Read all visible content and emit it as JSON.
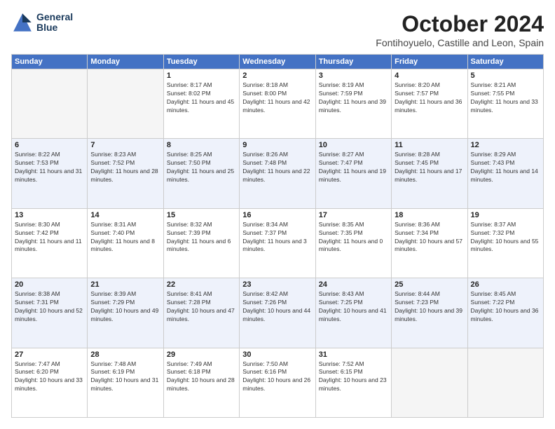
{
  "header": {
    "logo_line1": "General",
    "logo_line2": "Blue",
    "month": "October 2024",
    "location": "Fontihoyuelo, Castille and Leon, Spain"
  },
  "days_of_week": [
    "Sunday",
    "Monday",
    "Tuesday",
    "Wednesday",
    "Thursday",
    "Friday",
    "Saturday"
  ],
  "weeks": [
    [
      {
        "day": "",
        "info": ""
      },
      {
        "day": "",
        "info": ""
      },
      {
        "day": "1",
        "info": "Sunrise: 8:17 AM\nSunset: 8:02 PM\nDaylight: 11 hours and 45 minutes."
      },
      {
        "day": "2",
        "info": "Sunrise: 8:18 AM\nSunset: 8:00 PM\nDaylight: 11 hours and 42 minutes."
      },
      {
        "day": "3",
        "info": "Sunrise: 8:19 AM\nSunset: 7:59 PM\nDaylight: 11 hours and 39 minutes."
      },
      {
        "day": "4",
        "info": "Sunrise: 8:20 AM\nSunset: 7:57 PM\nDaylight: 11 hours and 36 minutes."
      },
      {
        "day": "5",
        "info": "Sunrise: 8:21 AM\nSunset: 7:55 PM\nDaylight: 11 hours and 33 minutes."
      }
    ],
    [
      {
        "day": "6",
        "info": "Sunrise: 8:22 AM\nSunset: 7:53 PM\nDaylight: 11 hours and 31 minutes."
      },
      {
        "day": "7",
        "info": "Sunrise: 8:23 AM\nSunset: 7:52 PM\nDaylight: 11 hours and 28 minutes."
      },
      {
        "day": "8",
        "info": "Sunrise: 8:25 AM\nSunset: 7:50 PM\nDaylight: 11 hours and 25 minutes."
      },
      {
        "day": "9",
        "info": "Sunrise: 8:26 AM\nSunset: 7:48 PM\nDaylight: 11 hours and 22 minutes."
      },
      {
        "day": "10",
        "info": "Sunrise: 8:27 AM\nSunset: 7:47 PM\nDaylight: 11 hours and 19 minutes."
      },
      {
        "day": "11",
        "info": "Sunrise: 8:28 AM\nSunset: 7:45 PM\nDaylight: 11 hours and 17 minutes."
      },
      {
        "day": "12",
        "info": "Sunrise: 8:29 AM\nSunset: 7:43 PM\nDaylight: 11 hours and 14 minutes."
      }
    ],
    [
      {
        "day": "13",
        "info": "Sunrise: 8:30 AM\nSunset: 7:42 PM\nDaylight: 11 hours and 11 minutes."
      },
      {
        "day": "14",
        "info": "Sunrise: 8:31 AM\nSunset: 7:40 PM\nDaylight: 11 hours and 8 minutes."
      },
      {
        "day": "15",
        "info": "Sunrise: 8:32 AM\nSunset: 7:39 PM\nDaylight: 11 hours and 6 minutes."
      },
      {
        "day": "16",
        "info": "Sunrise: 8:34 AM\nSunset: 7:37 PM\nDaylight: 11 hours and 3 minutes."
      },
      {
        "day": "17",
        "info": "Sunrise: 8:35 AM\nSunset: 7:35 PM\nDaylight: 11 hours and 0 minutes."
      },
      {
        "day": "18",
        "info": "Sunrise: 8:36 AM\nSunset: 7:34 PM\nDaylight: 10 hours and 57 minutes."
      },
      {
        "day": "19",
        "info": "Sunrise: 8:37 AM\nSunset: 7:32 PM\nDaylight: 10 hours and 55 minutes."
      }
    ],
    [
      {
        "day": "20",
        "info": "Sunrise: 8:38 AM\nSunset: 7:31 PM\nDaylight: 10 hours and 52 minutes."
      },
      {
        "day": "21",
        "info": "Sunrise: 8:39 AM\nSunset: 7:29 PM\nDaylight: 10 hours and 49 minutes."
      },
      {
        "day": "22",
        "info": "Sunrise: 8:41 AM\nSunset: 7:28 PM\nDaylight: 10 hours and 47 minutes."
      },
      {
        "day": "23",
        "info": "Sunrise: 8:42 AM\nSunset: 7:26 PM\nDaylight: 10 hours and 44 minutes."
      },
      {
        "day": "24",
        "info": "Sunrise: 8:43 AM\nSunset: 7:25 PM\nDaylight: 10 hours and 41 minutes."
      },
      {
        "day": "25",
        "info": "Sunrise: 8:44 AM\nSunset: 7:23 PM\nDaylight: 10 hours and 39 minutes."
      },
      {
        "day": "26",
        "info": "Sunrise: 8:45 AM\nSunset: 7:22 PM\nDaylight: 10 hours and 36 minutes."
      }
    ],
    [
      {
        "day": "27",
        "info": "Sunrise: 7:47 AM\nSunset: 6:20 PM\nDaylight: 10 hours and 33 minutes."
      },
      {
        "day": "28",
        "info": "Sunrise: 7:48 AM\nSunset: 6:19 PM\nDaylight: 10 hours and 31 minutes."
      },
      {
        "day": "29",
        "info": "Sunrise: 7:49 AM\nSunset: 6:18 PM\nDaylight: 10 hours and 28 minutes."
      },
      {
        "day": "30",
        "info": "Sunrise: 7:50 AM\nSunset: 6:16 PM\nDaylight: 10 hours and 26 minutes."
      },
      {
        "day": "31",
        "info": "Sunrise: 7:52 AM\nSunset: 6:15 PM\nDaylight: 10 hours and 23 minutes."
      },
      {
        "day": "",
        "info": ""
      },
      {
        "day": "",
        "info": ""
      }
    ]
  ]
}
